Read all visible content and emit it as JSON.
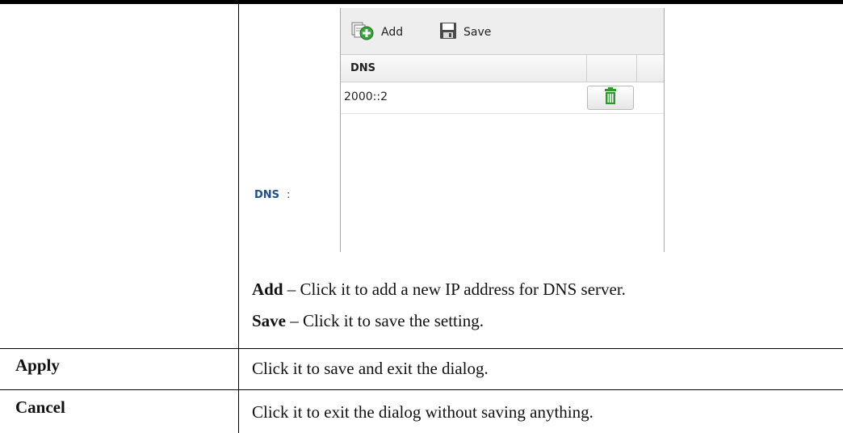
{
  "dns_panel": {
    "field_label": "DNS",
    "field_colon": ":",
    "toolbar": {
      "add_label": "Add",
      "save_label": "Save"
    },
    "grid": {
      "columns": [
        "DNS"
      ],
      "rows": [
        {
          "dns": "2000::2"
        }
      ]
    },
    "colors": {
      "label": "#1f4f8f",
      "delete_icon": "#2e9a2e",
      "save_icon": "#4a4a4a"
    },
    "icons": {
      "add": "add-circle-icon",
      "save": "floppy-disk-icon",
      "delete": "trash-icon"
    }
  },
  "descriptions": {
    "add": {
      "term": "Add",
      "text": " – Click it to add a new IP address for DNS server."
    },
    "save": {
      "term": "Save",
      "text": " – Click it to save the setting."
    }
  },
  "rows": [
    {
      "term": "Apply",
      "description": "Click it to save and exit the dialog."
    },
    {
      "term": "Cancel",
      "description": "Click it to exit the dialog without saving anything."
    }
  ]
}
